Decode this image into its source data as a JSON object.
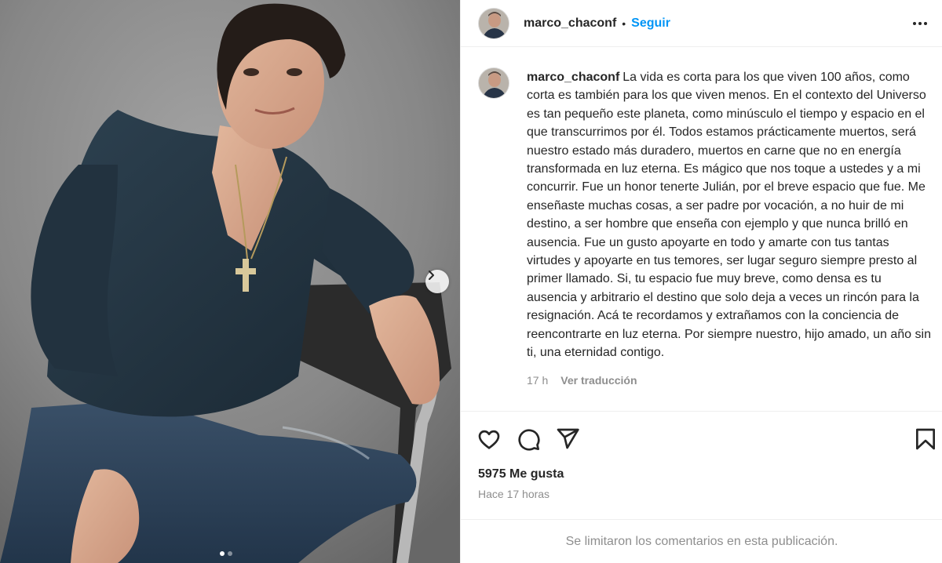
{
  "post": {
    "author": "marco_chaconf",
    "separator": "•",
    "follow_label": "Seguir",
    "caption": "La vida es corta para los que viven 100 años, como corta es también para los que viven menos. En el contexto del Universo es tan pequeño este planeta, como minúsculo el tiempo y espacio en el que transcurrimos por él. Todos estamos prácticamente muertos, será nuestro estado más duradero, muertos en carne que no en energía transformada en luz eterna. Es mágico que nos toque a ustedes y a mi concurrir. Fue un honor tenerte Julián, por el breve espacio que fue. Me enseñaste muchas cosas, a ser padre por vocación, a no huir de mi destino, a ser hombre que enseña con ejemplo y que nunca brilló en ausencia. Fue un gusto apoyarte en todo y amarte con tus tantas virtudes y apoyarte en tus temores, ser lugar seguro siempre presto al primer llamado. Si, tu espacio fue muy breve, como densa es tu ausencia y arbitrario el destino que solo deja a veces un rincón para la resignación. Acá te recordamos y extrañamos con la conciencia de reencontrarte en luz eterna. Por siempre nuestro, hijo amado, un año sin ti, una eternidad contigo.",
    "caption_age": "17 h",
    "translate_label": "Ver traducción",
    "likes": "5975 Me gusta",
    "posted_time": "Hace 17 horas",
    "comments_disabled": "Se limitaron los comentarios en esta publicación."
  },
  "carousel": {
    "total": 2,
    "current": 1
  },
  "icons": {
    "more": "more-options-icon",
    "like": "heart-icon",
    "comment": "comment-icon",
    "share": "share-icon",
    "save": "bookmark-icon",
    "next": "chevron-right-icon"
  },
  "colors": {
    "accent": "#0095f6",
    "muted": "#8e8e8e",
    "text": "#262626"
  }
}
